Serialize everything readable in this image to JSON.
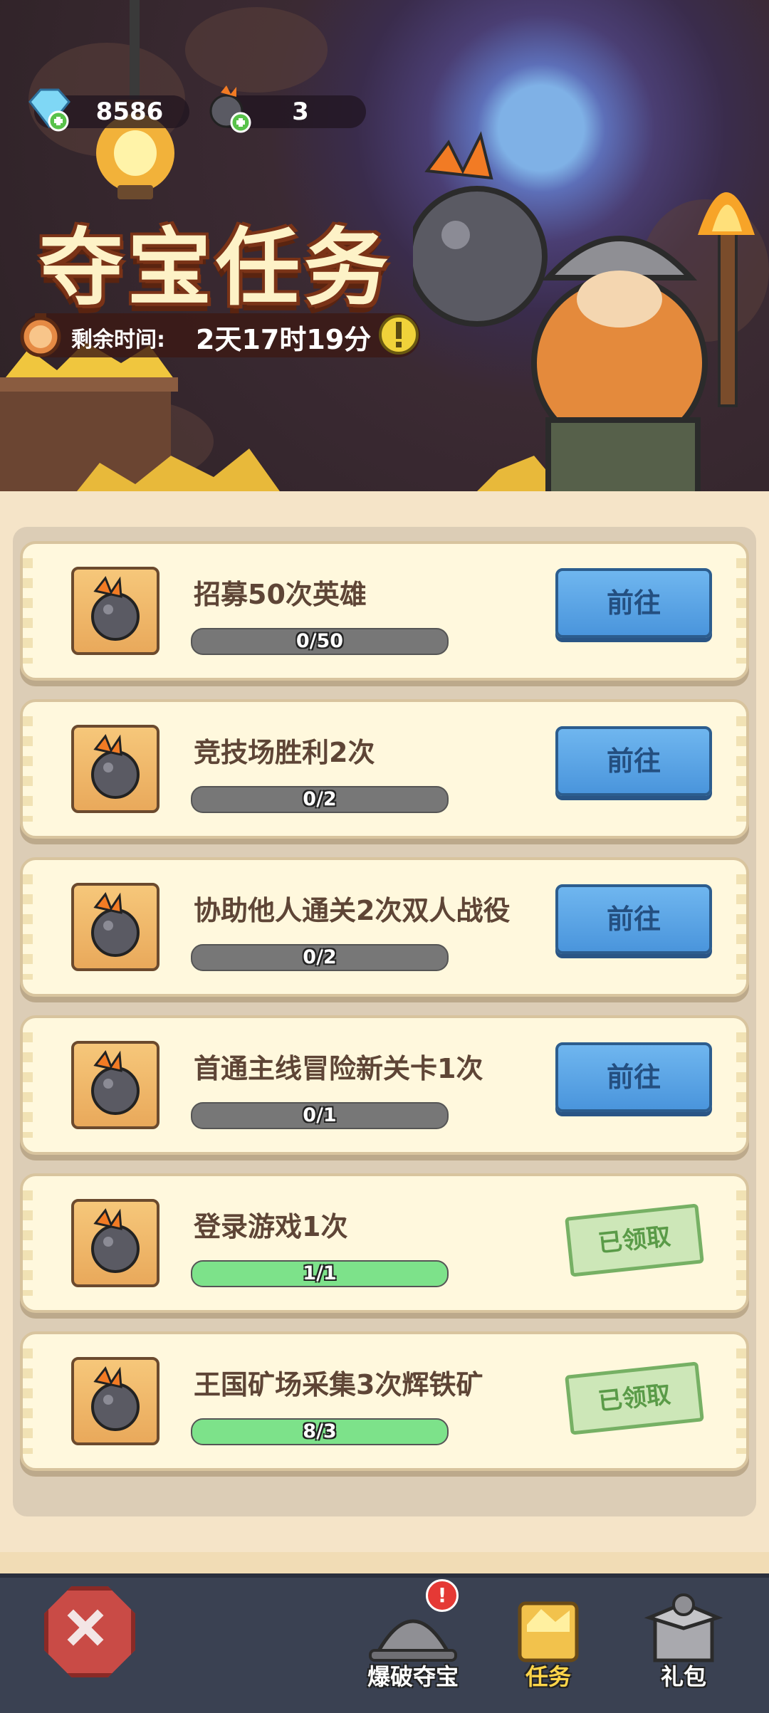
{
  "header": {
    "gems": "8586",
    "bombs": "3",
    "title": "夺宝任务",
    "timer_label": "剩余时间:",
    "timer_value": "2天17时19分",
    "info_icon": "exclamation-icon"
  },
  "tasks": [
    {
      "name": "招募50次英雄",
      "progress_text": "0/50",
      "progress": 0,
      "action": "前往",
      "state": "go"
    },
    {
      "name": "竞技场胜利2次",
      "progress_text": "0/2",
      "progress": 0,
      "action": "前往",
      "state": "go"
    },
    {
      "name": "协助他人通关2次双人战役",
      "progress_text": "0/2",
      "progress": 0,
      "action": "前往",
      "state": "go"
    },
    {
      "name": "首通主线冒险新关卡1次",
      "progress_text": "0/1",
      "progress": 0,
      "action": "前往",
      "state": "go"
    },
    {
      "name": "登录游戏1次",
      "progress_text": "1/1",
      "progress": 1,
      "action": "已领取",
      "state": "claimed"
    },
    {
      "name": "王国矿场采集3次辉铁矿",
      "progress_text": "8/3",
      "progress": 1,
      "action": "已领取",
      "state": "claimed"
    }
  ],
  "nav": {
    "items": [
      {
        "label": "爆破夺宝",
        "icon": "helmet-icon"
      },
      {
        "label": "任务",
        "icon": "gold-ore-icon"
      },
      {
        "label": "礼包",
        "icon": "gift-box-icon"
      }
    ],
    "badge": "!"
  },
  "colors": {
    "go_button": "#4a95dc",
    "claimed_stamp": "#76b064",
    "progress_full": "#7de28a",
    "progress_empty": "#777777",
    "nav_bg": "#3a4152"
  }
}
